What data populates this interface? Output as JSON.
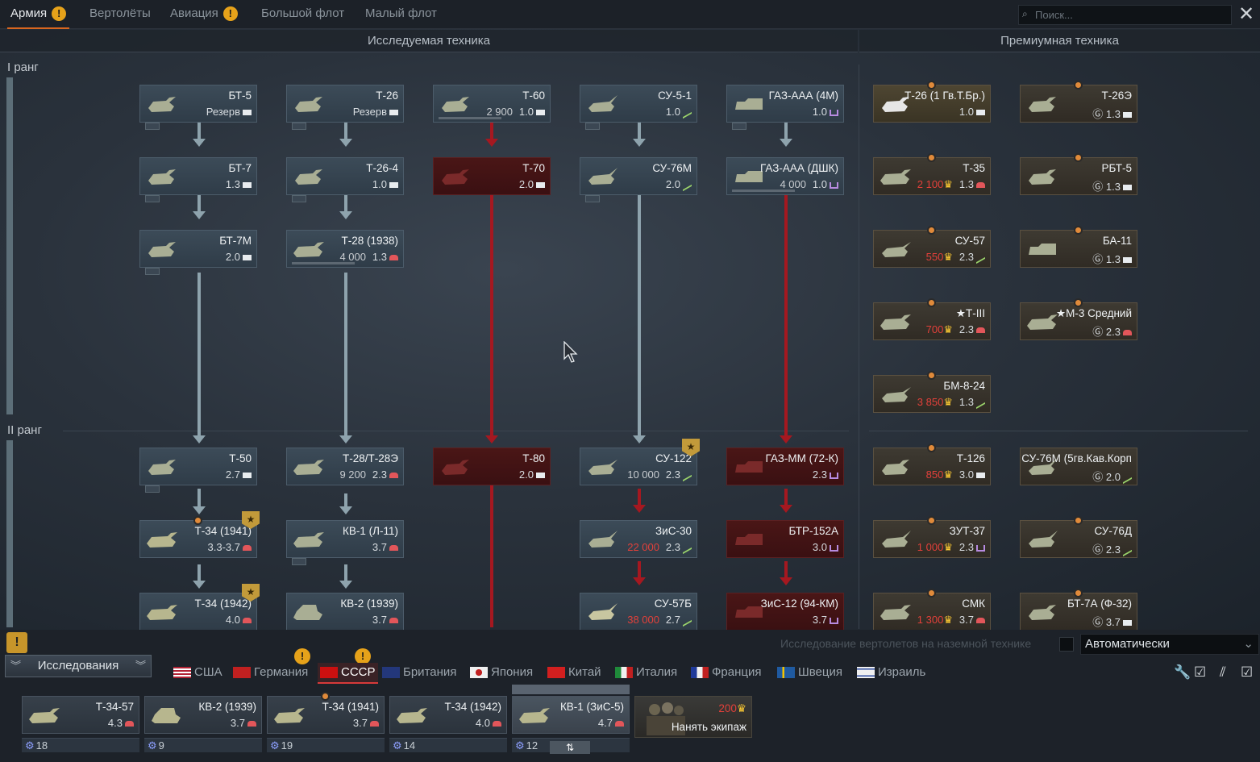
{
  "top_tabs": [
    {
      "label": "Армия",
      "warn": true,
      "active": true
    },
    {
      "label": "Вертолёты",
      "warn": false
    },
    {
      "label": "Авиация",
      "warn": true
    },
    {
      "label": "Большой флот",
      "warn": false
    },
    {
      "label": "Малый флот",
      "warn": false
    }
  ],
  "search": {
    "placeholder": "Поиск..."
  },
  "sections": {
    "research": "Исследуемая техника",
    "premium": "Премиумная техника"
  },
  "ranks": {
    "r1": "I ранг",
    "r2": "II ранг"
  },
  "vehicles": {
    "bt5": {
      "name": "БТ-5",
      "br": "Резерв"
    },
    "t26": {
      "name": "Т-26",
      "br": "Резерв"
    },
    "t60": {
      "name": "Т-60",
      "cost": "2 900",
      "br": "1.0"
    },
    "su51": {
      "name": "СУ-5-1",
      "br": "1.0"
    },
    "gazaaa4m": {
      "name": "ГАЗ-ААА (4М)",
      "br": "1.0"
    },
    "bt7": {
      "name": "БТ-7",
      "br": "1.3"
    },
    "t264": {
      "name": "Т-26-4",
      "br": "1.0"
    },
    "t70": {
      "name": "Т-70",
      "br": "2.0"
    },
    "su76m": {
      "name": "СУ-76М",
      "br": "2.0"
    },
    "gazaaadshk": {
      "name": "ГАЗ-ААА (ДШК)",
      "cost": "4 000",
      "br": "1.0"
    },
    "bt7m": {
      "name": "БТ-7М",
      "br": "2.0"
    },
    "t28": {
      "name": "Т-28 (1938)",
      "cost": "4 000",
      "br": "1.3"
    },
    "t50": {
      "name": "Т-50",
      "br": "2.7"
    },
    "t28e": {
      "name": "Т-28/Т-28Э",
      "cost": "9 200",
      "br": "2.3"
    },
    "t80": {
      "name": "Т-80",
      "br": "2.0"
    },
    "su122": {
      "name": "СУ-122",
      "cost": "10 000",
      "br": "2.3"
    },
    "gazmm": {
      "name": "ГАЗ-ММ (72-К)",
      "br": "2.3"
    },
    "t341941": {
      "name": "Т-34 (1941)",
      "br": "3.3-3.7"
    },
    "kv1l11": {
      "name": "КВ-1 (Л-11)",
      "br": "3.7"
    },
    "zis30": {
      "name": "ЗиС-30",
      "cost": "22 000",
      "br": "2.3"
    },
    "btr152a": {
      "name": "БТР-152А",
      "br": "3.0"
    },
    "t341942": {
      "name": "Т-34 (1942)",
      "br": "4.0"
    },
    "kv21939": {
      "name": "КВ-2 (1939)",
      "br": "3.7"
    },
    "su57b": {
      "name": "СУ-57Б",
      "cost": "38 000",
      "br": "2.7"
    },
    "zis12": {
      "name": "ЗиС-12 (94-КМ)",
      "br": "3.7"
    },
    "p_t26gv": {
      "name": "Т-26 (1 Гв.Т.Бр.)",
      "br": "1.0"
    },
    "p_t26e": {
      "name": "Т-26Э",
      "br": "1.3"
    },
    "p_t35": {
      "name": "Т-35",
      "cost": "2 100",
      "br": "1.3"
    },
    "p_rbt5": {
      "name": "РБТ-5",
      "br": "1.3"
    },
    "p_su57": {
      "name": "СУ-57",
      "cost": "550",
      "br": "2.3"
    },
    "p_ba11": {
      "name": "БА-11",
      "br": "1.3"
    },
    "p_t3": {
      "name": "★Т-III",
      "cost": "700",
      "br": "2.3"
    },
    "p_m3": {
      "name": "★М-3 Средний",
      "br": "2.3"
    },
    "p_bm824": {
      "name": "БМ-8-24",
      "cost": "3 850",
      "br": "1.3"
    },
    "p_t126": {
      "name": "Т-126",
      "cost": "850",
      "br": "3.0"
    },
    "p_su76m5": {
      "name": "СУ-76М (5гв.Кав.Корп",
      "br": "2.0"
    },
    "p_zut37": {
      "name": "ЗУТ-37",
      "cost": "1 000",
      "br": "2.3"
    },
    "p_su76d": {
      "name": "СУ-76Д",
      "br": "2.3"
    },
    "p_smk": {
      "name": "СМК",
      "cost": "1 300",
      "br": "3.7"
    },
    "p_bt7a": {
      "name": "БТ-7А (Ф-32)",
      "br": "3.7"
    }
  },
  "bottom": {
    "heli_label": "Исследование вертолетов на наземной технике",
    "mode": "Автоматически",
    "research_button": "Исследования",
    "nations": [
      "США",
      "Германия",
      "СССР",
      "Британия",
      "Япония",
      "Китай",
      "Италия",
      "Франция",
      "Швеция",
      "Израиль"
    ],
    "active_nation": "СССР",
    "slots": [
      {
        "name": "Т-34-57",
        "br": "4.3",
        "crew": "18"
      },
      {
        "name": "КВ-2 (1939)",
        "br": "3.7",
        "crew": "9"
      },
      {
        "name": "Т-34 (1941)",
        "br": "3.7",
        "crew": "19"
      },
      {
        "name": "Т-34 (1942)",
        "br": "4.0",
        "crew": "14"
      },
      {
        "name": "КВ-1 (ЗиС-5)",
        "br": "4.7",
        "crew": "12"
      }
    ],
    "hire": {
      "price": "200",
      "label": "Нанять экипаж"
    }
  }
}
